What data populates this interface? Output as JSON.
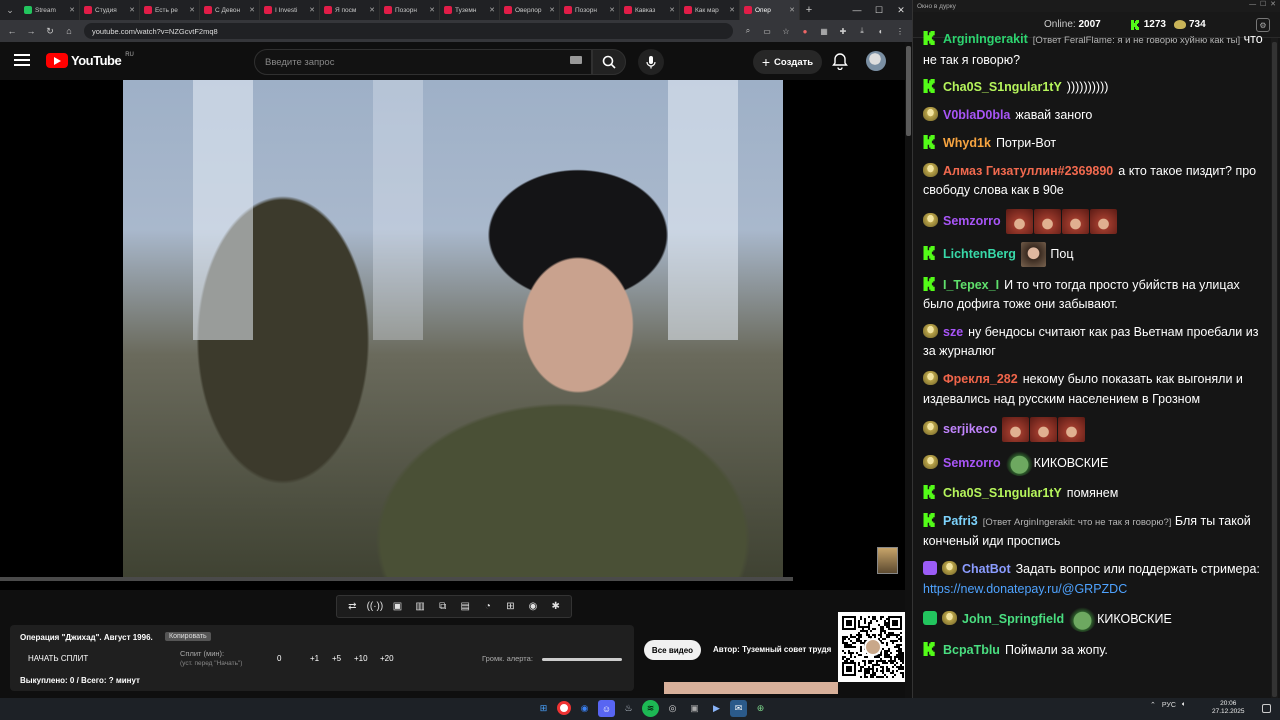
{
  "browser": {
    "tabs": [
      {
        "title": "Stream",
        "color": "#22c55e",
        "active": false
      },
      {
        "title": "Студия",
        "color": "#e11d48",
        "active": false
      },
      {
        "title": "Есть ре",
        "color": "#e11d48",
        "active": false
      },
      {
        "title": "С Девон",
        "color": "#e11d48",
        "active": false
      },
      {
        "title": "I Investi",
        "color": "#e11d48",
        "active": false
      },
      {
        "title": "Я посм",
        "color": "#e11d48",
        "active": false
      },
      {
        "title": "Позорн",
        "color": "#e11d48",
        "active": false
      },
      {
        "title": "Туземн",
        "color": "#e11d48",
        "active": false
      },
      {
        "title": "Оверлор",
        "color": "#e11d48",
        "active": false
      },
      {
        "title": "Позорн",
        "color": "#e11d48",
        "active": false
      },
      {
        "title": "Кавказ",
        "color": "#e11d48",
        "active": false
      },
      {
        "title": "Как мар",
        "color": "#e11d48",
        "active": false
      },
      {
        "title": "Опер",
        "color": "#e11d48",
        "active": true
      }
    ],
    "url": "youtube.com/watch?v=NZGcvtF2mq8"
  },
  "youtube": {
    "logo_text": "YouTube",
    "region": "RU",
    "search_placeholder": "Введите запрос",
    "create_label": "Создать"
  },
  "extension": {
    "controls": [
      "⇄",
      "((·))",
      "▣",
      "▥",
      "⧉",
      "▤",
      "◔",
      "⊞",
      "◉",
      "✱"
    ],
    "video_title": "Операция \"Джихад\". Август 1996.",
    "copy_label": "Копировать",
    "start_split": "НАЧАТЬ СПЛИТ",
    "split_label": "Сплит (мин):",
    "split_hint": "(уст. перед \"Начать\")",
    "split_value": "0",
    "increments": [
      "+1",
      "+5",
      "+10",
      "+20"
    ],
    "alert_volume_label": "Громк. алерта:",
    "bought": "Выкуплено: 0 / Всего: ? минут"
  },
  "below_video": {
    "all_videos": "Все видео",
    "author": "Автор: Туземный совет трудя"
  },
  "chat": {
    "window_title": "Окно в дурку",
    "online_label": "Online:",
    "online_value": "2007",
    "kick_count": "1273",
    "coin_count": "734",
    "messages": [
      {
        "icon": "kick",
        "nick": "ArginIngerakit",
        "color": "#2dd36f",
        "reply": "[Ответ FeralFlame: я и не говорю хуйню как ты]",
        "text": "что не так я говорю?"
      },
      {
        "icon": "kick",
        "nick": "Cha0S_S1ngular1tY",
        "color": "#b6f55c",
        "text": "))))))))))"
      },
      {
        "icon": "coin",
        "nick": "V0blaD0bla",
        "color": "#a855f7",
        "text": "жавай заного"
      },
      {
        "icon": "kick",
        "nick": "Whyd1k",
        "color": "#f7a440",
        "text": "Потри-Вот"
      },
      {
        "icon": "coin",
        "nick": "Алмаз Гизатуллин#2369890",
        "color": "#f26a4f",
        "text": "а кто такое пиздит? про свободу слова как в 90е"
      },
      {
        "icon": "coin",
        "nick": "Semzorro",
        "color": "#a855f7",
        "text": "",
        "emotes": 4
      },
      {
        "icon": "kick",
        "nick": "LichtenBerg",
        "color": "#38d9a9",
        "text": "Поц",
        "emote_face": true
      },
      {
        "icon": "kick",
        "nick": "I_Tepex_I",
        "color": "#5fe06c",
        "text": "И то что тогда просто убийств на улицах было дофига тоже они забывают."
      },
      {
        "icon": "coin",
        "nick": "sze",
        "color": "#a855f7",
        "text": "ну бендосы считают как раз Вьетнам проебали из за журналюг"
      },
      {
        "icon": "coin",
        "nick": "Фрекля_282",
        "color": "#f0654a",
        "text": "некому было показать как выгоняли и издевались над русским населением в Грозном"
      },
      {
        "icon": "coin",
        "nick": "serjikeco",
        "color": "#c084fc",
        "text": "",
        "emotes": 3
      },
      {
        "icon": "coin",
        "nick": "Semzorro",
        "color": "#a855f7",
        "text": "КИКОВСКИЕ",
        "pepe": true
      },
      {
        "icon": "kick",
        "nick": "Cha0S_S1ngular1tY",
        "color": "#b6f55c",
        "text": "помянем"
      },
      {
        "icon": "kick",
        "nick": "Pafri3",
        "color": "#7dd3fc",
        "reply": "[Ответ ArginIngerakit: что не так я говорю?]",
        "text": "Бля ты такой конченый иди проспись"
      },
      {
        "icon": "bot",
        "nick": "ChatBot",
        "color": "#8b9cff",
        "text": "Задать вопрос или поддержать стримера:",
        "link": "https://new.donatepay.ru/@GRPZDC"
      },
      {
        "icon": "mod",
        "nick": "John_Springfield",
        "color": "#4ade80",
        "text": "КИКОВСКИЕ",
        "pepe": true
      },
      {
        "icon": "kick",
        "nick": "BcpaTblu",
        "color": "#4ade80",
        "text": "Поймали за жопу."
      }
    ]
  },
  "taskbar": {
    "lang": "РУС",
    "time": "20:06",
    "date": "27.12.2025"
  }
}
